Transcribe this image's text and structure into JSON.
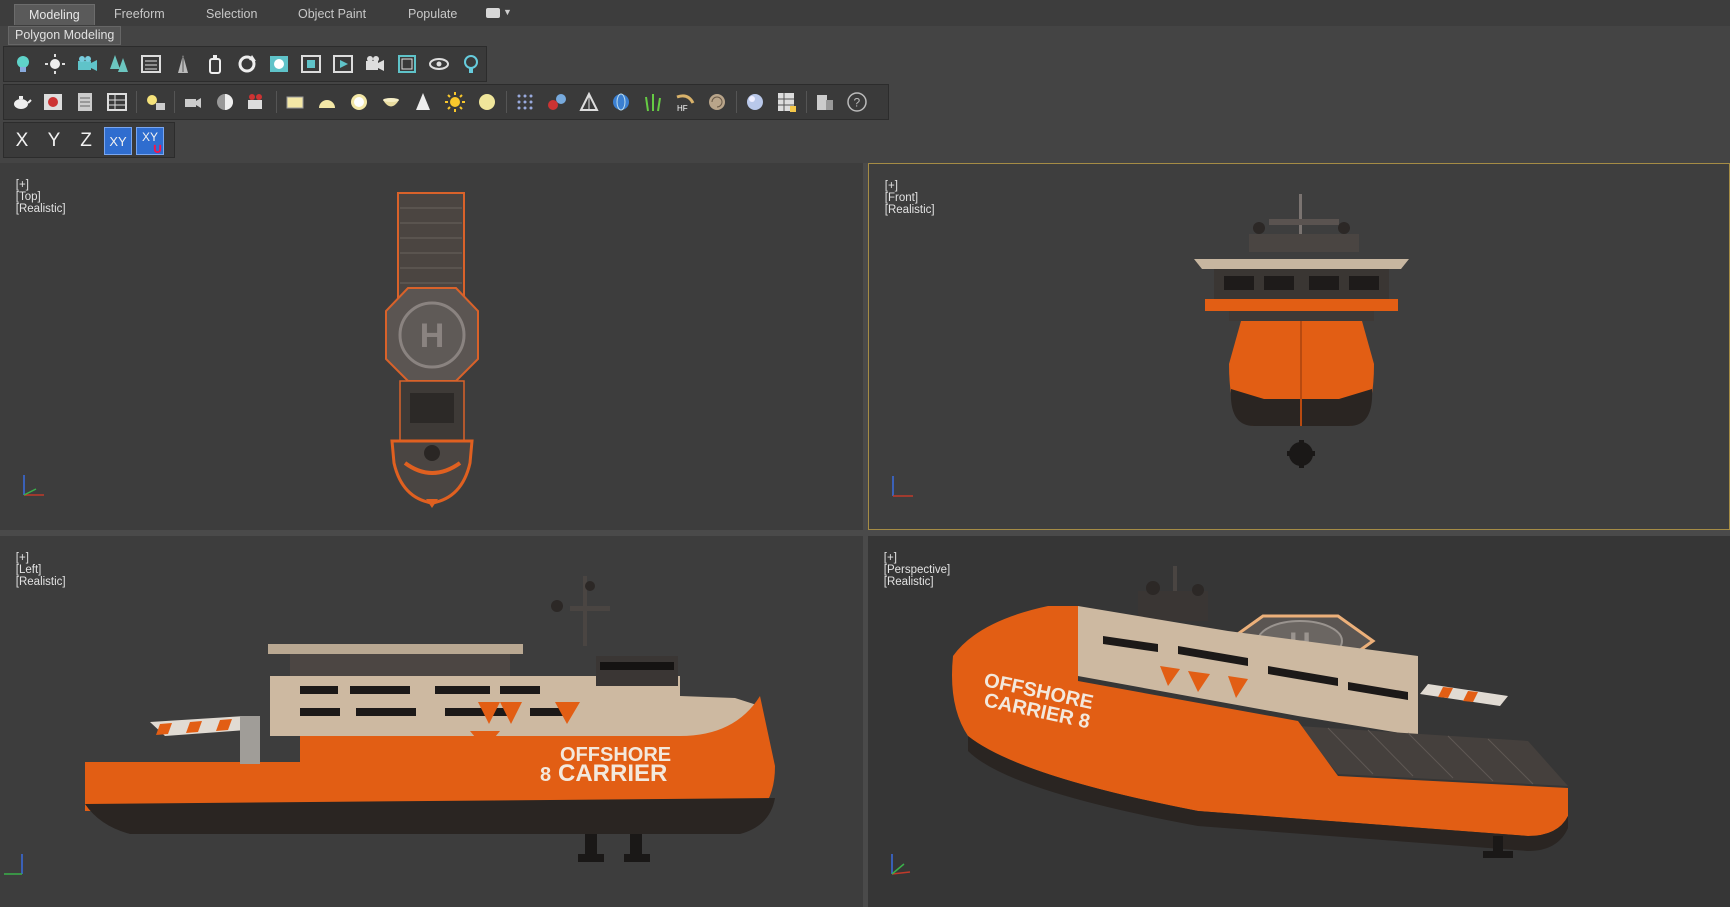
{
  "ribbon": {
    "tabs": [
      {
        "label": "Modeling",
        "active": true
      },
      {
        "label": "Freeform"
      },
      {
        "label": "Selection"
      },
      {
        "label": "Object Paint"
      },
      {
        "label": "Populate"
      }
    ],
    "subtab": "Polygon Modeling"
  },
  "toolbar_row1_icons": [
    "light-bulb-icon",
    "sun-icon",
    "camera-group-icon",
    "trees-icon",
    "list-icon",
    "bone-icon",
    "bottle-icon",
    "rotate-icon",
    "render-frame-icon",
    "snapshot-icon",
    "play-render-icon",
    "camera-icon",
    "frame-icon",
    "eye-icon",
    "bulb-outline-icon"
  ],
  "toolbar_row2_icons": [
    "teapot-icon",
    "image-viewer-icon",
    "material-list-icon",
    "table-icon",
    "light-lister-icon",
    "camera-move-icon",
    "half-sphere-icon",
    "film-camera-icon",
    "rectangle-icon",
    "dome-icon",
    "ring-icon",
    "bowl-icon",
    "cone-icon",
    "sun-icon",
    "sphere-icon",
    "particle-grid-icon",
    "molecule-icon",
    "tent-icon",
    "globe-icon",
    "grass-icon",
    "hf-icon",
    "shell-icon",
    "material-ball-icon",
    "scene-grid-icon",
    "layers-icon",
    "help-icon"
  ],
  "axis_constraints": {
    "x": "X",
    "y": "Y",
    "z": "Z",
    "xy": "XY",
    "xy_snap": "XY"
  },
  "viewports": {
    "top": {
      "plus": "[+]",
      "view": "[Top]",
      "shading": "[Realistic]"
    },
    "front": {
      "plus": "[+]",
      "view": "[Front]",
      "shading": "[Realistic]"
    },
    "left": {
      "plus": "[+]",
      "view": "[Left]",
      "shading": "[Realistic]"
    },
    "persp": {
      "plus": "[+]",
      "view": "[Perspective]",
      "shading": "[Realistic]"
    }
  },
  "hull_text": {
    "line1": "OFFSHORE",
    "line2_number": "8",
    "line2_word": "CARRIER"
  },
  "persp_hull_text": {
    "line1": "OFFSHORE",
    "line2": "CARRIER 8"
  },
  "colors": {
    "hull_orange": "#e25e14",
    "superstructure": "#cdb9a1",
    "bottom_dark": "#2a2522",
    "active_viewport_border": "#a58c45",
    "axis_active": "#2f6dcf"
  }
}
